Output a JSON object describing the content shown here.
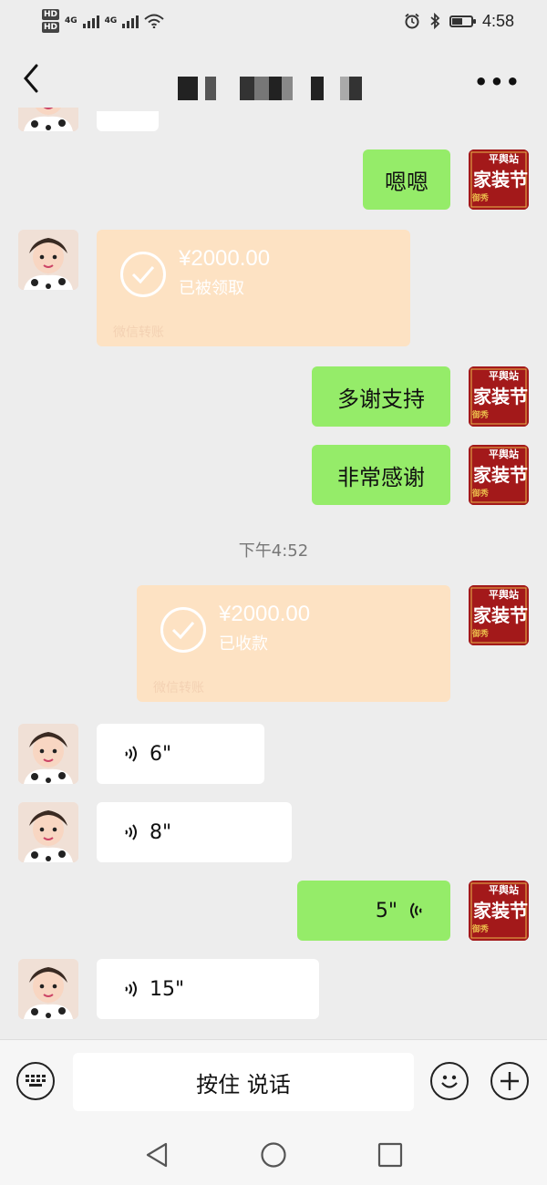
{
  "status": {
    "time": "4:58",
    "hd1": "HD",
    "hd2": "HD",
    "net1": "4G",
    "net2": "4G",
    "battery_level": 0.55
  },
  "header": {
    "title": ""
  },
  "messages": {
    "m1": "嗯嗯",
    "t1": {
      "amount": "¥2000.00",
      "status": "已被领取",
      "source": "微信转账"
    },
    "m2": "多谢支持",
    "m3": "非常感谢",
    "time": "下午4:52",
    "t2": {
      "amount": "¥2000.00",
      "status": "已收款",
      "source": "微信转账"
    },
    "v1": "6\"",
    "v2": "8\"",
    "v3": "5\"",
    "v4": "15\""
  },
  "shop_avatar": {
    "line1": "平舆站",
    "line2": "家装节",
    "line3": "御秀"
  },
  "input": {
    "hold_to_talk": "按住 说话"
  },
  "colors": {
    "green": "#95ec69",
    "transfer": "#fde2c3",
    "bg": "#ededed"
  }
}
